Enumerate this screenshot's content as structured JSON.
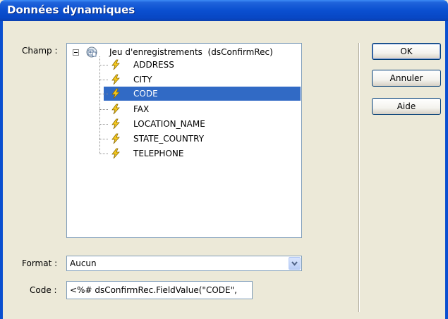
{
  "window": {
    "title": "Données dynamiques"
  },
  "field": {
    "label": "Champ :",
    "root": {
      "label": "Jeu d'enregistrements  (dsConfirmRec)"
    },
    "items": [
      {
        "label": "ADDRESS",
        "selected": false
      },
      {
        "label": "CITY",
        "selected": false
      },
      {
        "label": "CODE",
        "selected": true
      },
      {
        "label": "FAX",
        "selected": false
      },
      {
        "label": "LOCATION_NAME",
        "selected": false
      },
      {
        "label": "STATE_COUNTRY",
        "selected": false
      },
      {
        "label": "TELEPHONE",
        "selected": false
      }
    ]
  },
  "format": {
    "label": "Format :",
    "value": "Aucun"
  },
  "code": {
    "label": "Code :",
    "value": "<%# dsConfirmRec.FieldValue(\"CODE\","
  },
  "buttons": {
    "ok": "OK",
    "cancel": "Annuler",
    "help": "Aide"
  },
  "colors": {
    "selection": "#316ac5",
    "titlebar": "#0a4fd0",
    "dialog_bg": "#ece9d8"
  }
}
